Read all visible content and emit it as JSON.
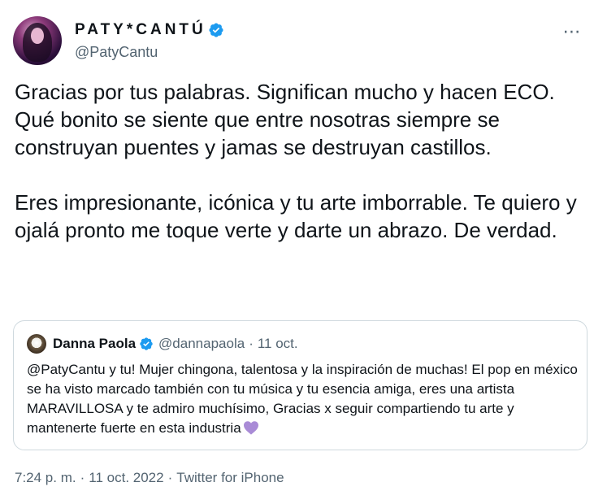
{
  "author": {
    "display_name": "PATY*CANTÚ",
    "handle": "@PatyCantu",
    "verified": true,
    "more_icon": "⋯"
  },
  "tweet": {
    "text": "Gracias por tus palabras. Significan mucho y hacen ECO.\nQué bonito se siente que entre nosotras siempre se construyan puentes y jamas se destruyan castillos.\n\nEres impresionante, icónica y tu arte imborrable. Te quiero y ojalá pronto me toque verte y darte un abrazo. De verdad."
  },
  "quoted_tweet": {
    "display_name": "Danna Paola",
    "handle": "@dannapaola",
    "separator": "·",
    "date": "11 oct.",
    "text": "@PatyCantu y tu! Mujer chingona, talentosa y la inspiración de muchas! El pop en méxico se ha visto marcado también con tu música y tu esencia amiga, eres una artista MARAVILLOSA y te admiro muchísimo, Gracias x seguir compartiendo tu arte y mantenerte fuerte en esta industria",
    "emoji": "purple-heart"
  },
  "footer": {
    "time": "7:24 p. m.",
    "date": "11 oct. 2022",
    "source": "Twitter for iPhone",
    "separator": "·"
  },
  "colors": {
    "verified_blue": "#1d9bf0",
    "secondary_text": "#536471",
    "border": "#cfd9de",
    "heart_purple": "#a98bd6"
  }
}
